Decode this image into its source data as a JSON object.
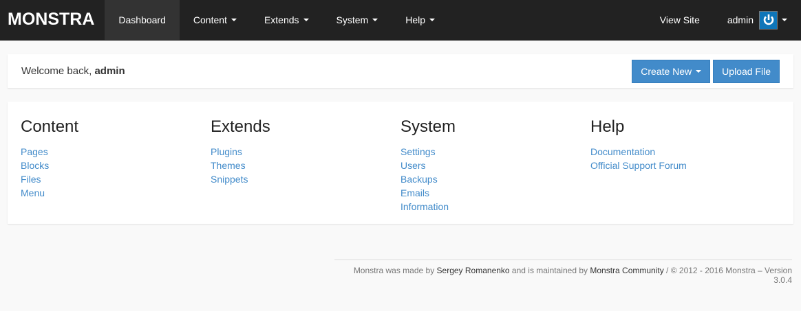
{
  "nav": {
    "brand": "MONSTRA",
    "items": [
      {
        "label": "Dashboard",
        "active": true
      },
      {
        "label": "Content"
      },
      {
        "label": "Extends"
      },
      {
        "label": "System"
      },
      {
        "label": "Help"
      }
    ],
    "view_site": "View Site",
    "user": "admin",
    "avatar_icon": "power-icon"
  },
  "welcome": {
    "prefix": "Welcome back, ",
    "user": "admin",
    "create_new": "Create New",
    "upload_file": "Upload File"
  },
  "sections": [
    {
      "title": "Content",
      "links": [
        "Pages",
        "Blocks",
        "Files",
        "Menu"
      ]
    },
    {
      "title": "Extends",
      "links": [
        "Plugins",
        "Themes",
        "Snippets"
      ]
    },
    {
      "title": "System",
      "links": [
        "Settings",
        "Users",
        "Backups",
        "Emails",
        "Information"
      ]
    },
    {
      "title": "Help",
      "links": [
        "Documentation",
        "Official Support Forum"
      ]
    }
  ],
  "footer": {
    "t1": "Monstra was made by ",
    "author": "Sergey Romanenko",
    "t2": " and is maintained by ",
    "community": "Monstra Community",
    "t3": " / © 2012 - 2016 Monstra – Version 3.0.4"
  },
  "colors": {
    "accent": "#428bca",
    "navbar": "#222222"
  }
}
